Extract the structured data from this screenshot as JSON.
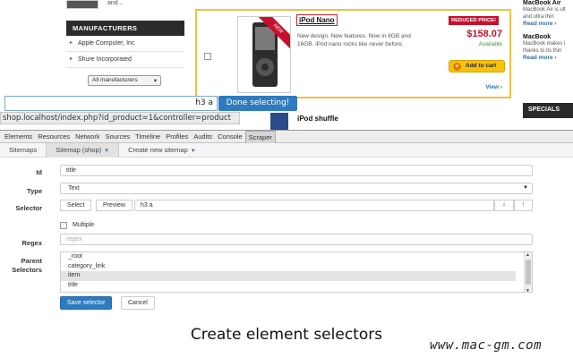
{
  "site": {
    "top_more": "and...",
    "manufacturers": {
      "title": "MANUFACTURERS",
      "items": [
        "Apple Computer, Inc",
        "Shure Incorporated"
      ],
      "select_value": "All manufacturers"
    },
    "product": {
      "ribbon": "NEW",
      "title": "iPod Nano",
      "description": "New design. New features. Now in 8GB and 16GB. iPod nano rocks like never before.",
      "badge": "REDUCED PRICE!",
      "price": "$158.07",
      "availability": "Available",
      "add_to_cart": "Add to cart",
      "view": "View ›"
    },
    "right_column": {
      "item1_title": "MacBook Air",
      "item1_text_1": "MacBook Air is ult",
      "item1_text_2": "and ultra thin",
      "item1_more": "Read more ›",
      "item2_title": "MacBook",
      "item2_text_1": "MacBook makes i",
      "item2_text_2": "thanks to its thin",
      "item2_more": "Read more ›",
      "specials": "SPECIALS"
    },
    "next_product_title": "iPod shuffle"
  },
  "selection_bar": {
    "selector_value": "h3 a",
    "done_button": "Done selecting!",
    "url_tooltip": "shop.localhost/index.php?id_product=1&controller=product"
  },
  "devtools": {
    "tabs": [
      "Elements",
      "Resources",
      "Network",
      "Sources",
      "Timeline",
      "Profiles",
      "Audits",
      "Console",
      "Scraper"
    ],
    "active_tab": "Scraper",
    "sub_tabs": {
      "sitemaps": "Sitemaps",
      "sitemap_shop": "Sitemap (shop)",
      "create_new": "Create new sitemap"
    },
    "form": {
      "id_label": "Id",
      "id_value": "title",
      "type_label": "Type",
      "type_value": "Text",
      "selector_label": "Selector",
      "select_button": "Select",
      "preview_button": "Preview",
      "selector_value": "h3 a",
      "multiple_label": "Multiple",
      "regex_label": "Regex",
      "regex_placeholder": "regex",
      "parent_label_1": "Parent",
      "parent_label_2": "Selectors",
      "parent_options": [
        "_root",
        "category_link",
        "item",
        "title"
      ],
      "parent_selected": "item",
      "save_button": "Save selector",
      "cancel_button": "Cancel"
    }
  },
  "caption": "Create element selectors",
  "watermark": "www.mac-gm.com",
  "colors": {
    "accent_blue": "#2f7bbf",
    "price_red": "#c8102e",
    "highlight_yellow": "#f0c040",
    "dark_header": "#2b2b2b"
  }
}
